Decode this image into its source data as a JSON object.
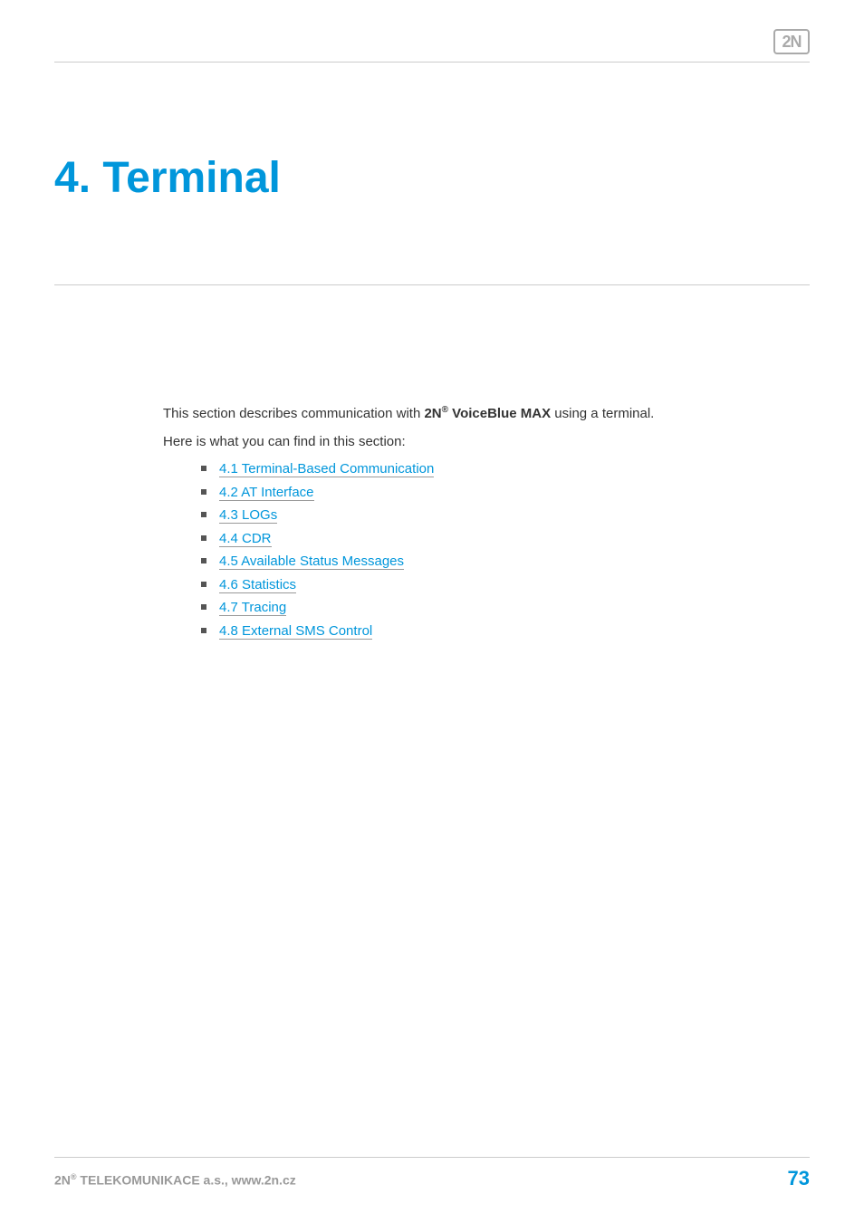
{
  "header": {
    "logo_text": "2N"
  },
  "title": "4. Terminal",
  "intro": {
    "prefix": "This section describes communication with ",
    "brand_prefix": "2N",
    "brand_suffix": " VoiceBlue MAX",
    "suffix": " using a terminal.",
    "subline": "Here is what you can find in this section:"
  },
  "toc": [
    "4.1 Terminal-Based Communication",
    "4.2 AT Interface",
    "4.3 LOGs",
    "4.4 CDR",
    "4.5 Available Status Messages",
    "4.6 Statistics",
    "4.7 Tracing",
    "4.8 External SMS Control"
  ],
  "footer": {
    "company_prefix": "2N",
    "company_suffix": " TELEKOMUNIKACE a.s., www.2n.cz",
    "page_number": "73"
  }
}
